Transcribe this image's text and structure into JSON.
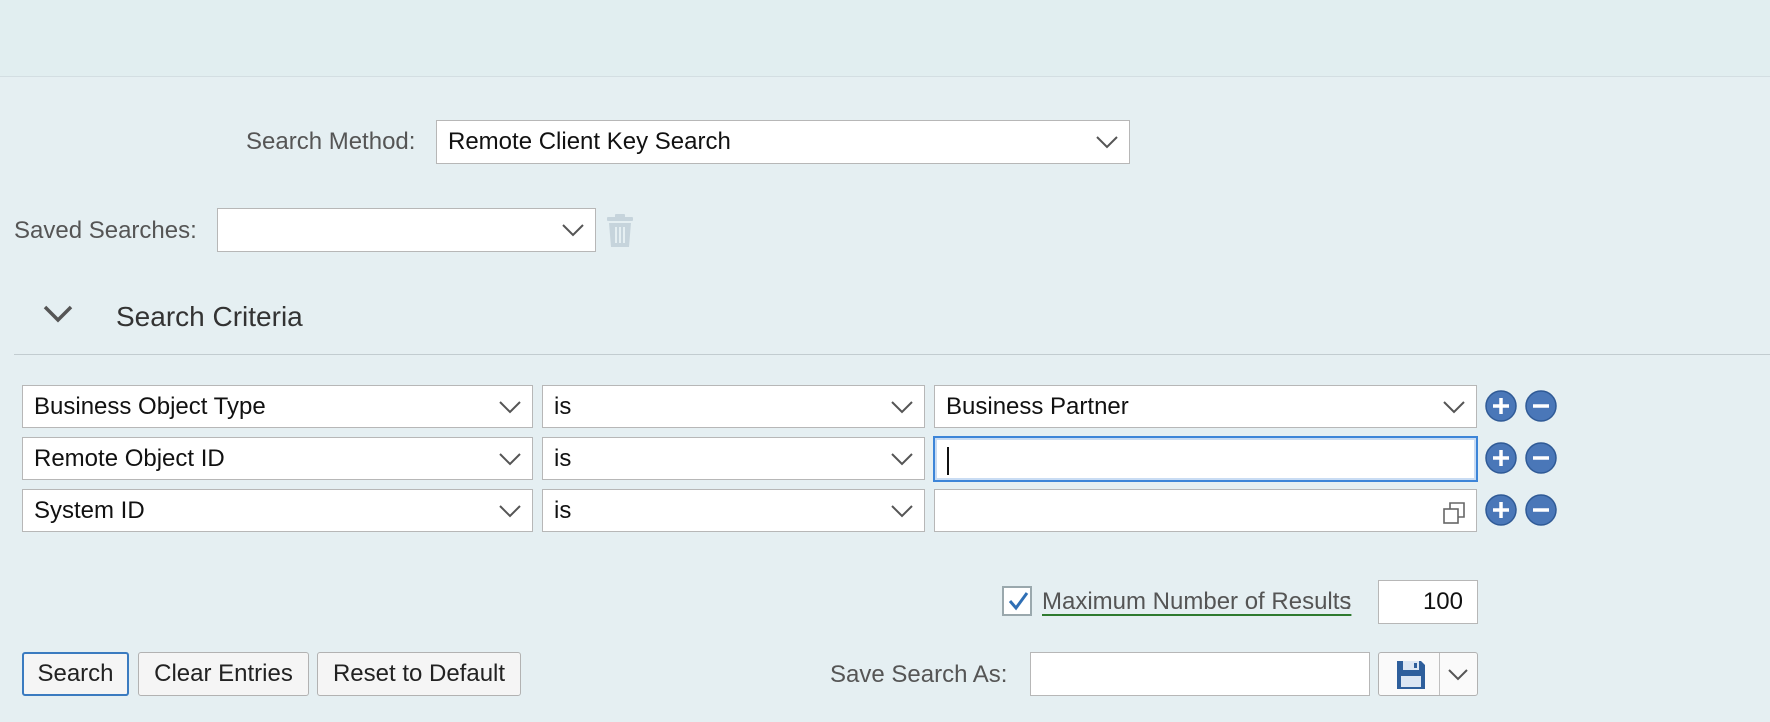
{
  "search_method": {
    "label": "Search Method:",
    "value": "Remote Client Key Search"
  },
  "saved_searches": {
    "label": "Saved Searches:",
    "value": ""
  },
  "criteria_section": {
    "title": "Search Criteria",
    "rows": [
      {
        "field": "Business Object Type",
        "operator": "is",
        "value": "Business Partner",
        "value_kind": "dropdown"
      },
      {
        "field": "Remote Object ID",
        "operator": "is",
        "value": "",
        "value_kind": "text-focused"
      },
      {
        "field": "System ID",
        "operator": "is",
        "value": "",
        "value_kind": "value-help"
      }
    ]
  },
  "max_results": {
    "checked": true,
    "label": "Maximum Number of Results",
    "colon": ":",
    "value": "100"
  },
  "buttons": {
    "search": "Search",
    "clear": "Clear Entries",
    "reset": "Reset to Default"
  },
  "save_search": {
    "label": "Save Search As:",
    "value": ""
  },
  "icons": {
    "add": "plus-circle-icon",
    "remove": "minus-circle-icon",
    "trash": "trash-icon",
    "save": "floppy-disk-icon",
    "value_help": "value-help-icon"
  },
  "colors": {
    "background": "#e5eff2",
    "focus_border": "#3d85d8",
    "round_button": "#4a77b8",
    "max_results_underline": "#2f7a2f"
  }
}
